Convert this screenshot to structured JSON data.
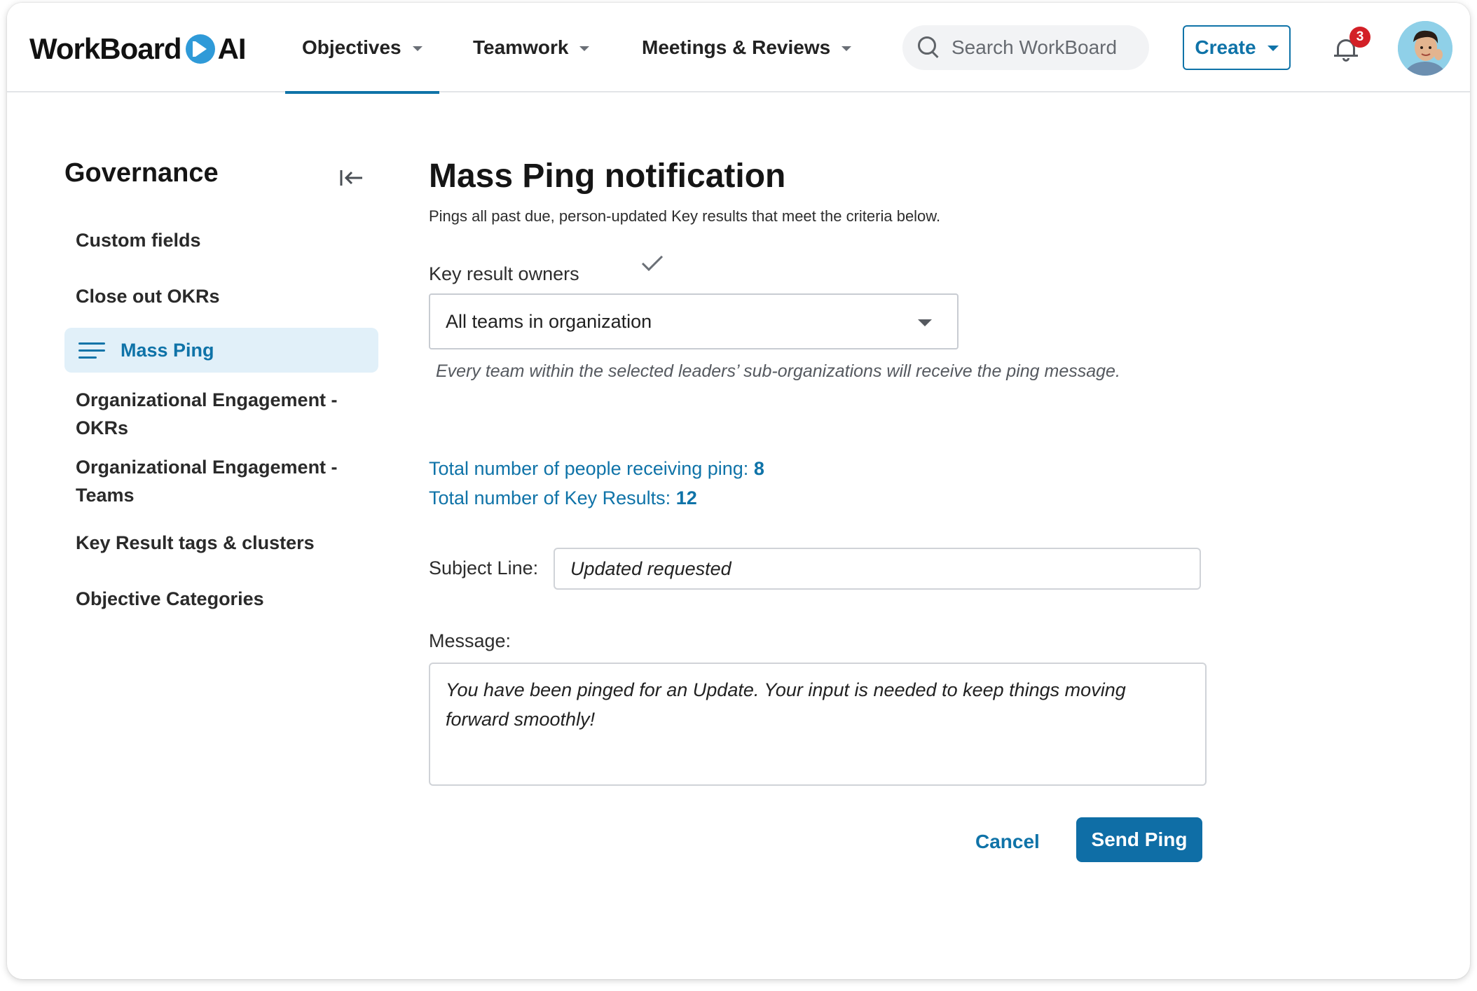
{
  "app": {
    "logo_text": "WorkBoard",
    "logo_suffix": "AI"
  },
  "nav": {
    "tabs": [
      {
        "label": "Objectives",
        "active": true
      },
      {
        "label": "Teamwork",
        "active": false
      },
      {
        "label": "Meetings & Reviews",
        "active": false
      }
    ],
    "search_placeholder": "Search WorkBoard",
    "create_label": "Create",
    "notification_count": "3"
  },
  "sidebar": {
    "title": "Governance",
    "items": [
      {
        "label": "Custom fields"
      },
      {
        "label": "Close out OKRs"
      },
      {
        "label": "Mass Ping",
        "active": true
      },
      {
        "label": "Organizational Engagement - OKRs"
      },
      {
        "label": "Organizational Engagement - Teams"
      },
      {
        "label": "Key Result tags & clusters"
      },
      {
        "label": "Objective Categories"
      }
    ]
  },
  "main": {
    "title": "Mass Ping notification",
    "subtitle": "Pings all past due, person-updated Key results that meet the criteria below.",
    "owners_label": "Key result owners",
    "owners_value": "All teams in organization",
    "owners_hint": "Every team within the selected leaders’ sub-organizations will receive the ping message.",
    "people_label": "Total number of people receiving ping:",
    "people_count": "8",
    "kr_label": "Total number of Key Results:",
    "kr_count": "12",
    "subject_label": "Subject Line:",
    "subject_value": "Updated requested",
    "message_label": "Message:",
    "message_value": "You have been pinged for an Update. Your input is needed to keep things moving forward smoothly!",
    "cancel_label": "Cancel",
    "send_label": "Send Ping"
  },
  "colors": {
    "accent": "#0f73a8",
    "active_bg": "#e1f0f9",
    "badge": "#d32027"
  }
}
